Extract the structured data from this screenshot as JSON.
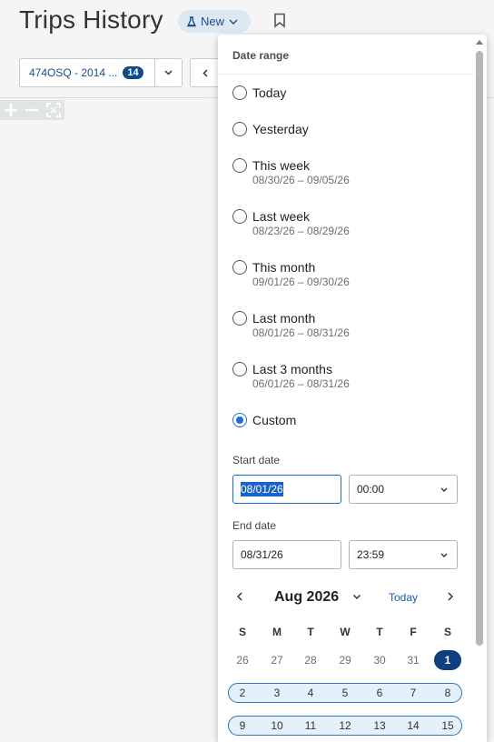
{
  "header": {
    "title": "Trips History",
    "new_label": "New"
  },
  "toolbar": {
    "vehicle_label": "474OSQ - 2014 ...",
    "vehicle_count": "14"
  },
  "popup": {
    "heading": "Date range",
    "options": [
      {
        "label": "Today",
        "sub": ""
      },
      {
        "label": "Yesterday",
        "sub": ""
      },
      {
        "label": "This week",
        "sub": "08/30/26 – 09/05/26"
      },
      {
        "label": "Last week",
        "sub": "08/23/26 – 08/29/26"
      },
      {
        "label": "This month",
        "sub": "09/01/26 – 09/30/26"
      },
      {
        "label": "Last month",
        "sub": "08/01/26 – 08/31/26"
      },
      {
        "label": "Last 3 months",
        "sub": "06/01/26 – 08/31/26"
      },
      {
        "label": "Custom",
        "sub": ""
      }
    ],
    "selected_option": "Custom",
    "start_date_label": "Start date",
    "start_date_value": "08/01/26",
    "start_time_value": "00:00",
    "end_date_label": "End date",
    "end_date_value": "08/31/26",
    "end_time_value": "23:59"
  },
  "calendar": {
    "month_label": "Aug 2026",
    "today_label": "Today",
    "weekdays": [
      "S",
      "M",
      "T",
      "W",
      "T",
      "F",
      "S"
    ],
    "week1": [
      "26",
      "27",
      "28",
      "29",
      "30",
      "31",
      "1"
    ],
    "week2": [
      "2",
      "3",
      "4",
      "5",
      "6",
      "7",
      "8"
    ],
    "week3": [
      "9",
      "10",
      "11",
      "12",
      "13",
      "14",
      "15"
    ],
    "accent_color": "#0f3f7e"
  }
}
